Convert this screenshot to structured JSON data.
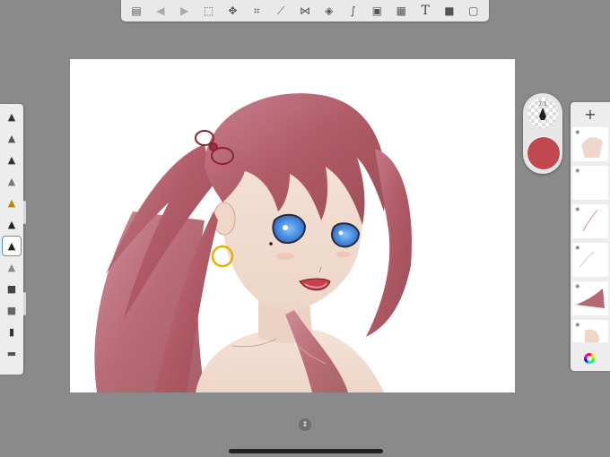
{
  "toolbar": {
    "items": [
      {
        "name": "gallery-icon",
        "glyph": "▤"
      },
      {
        "name": "undo-icon",
        "glyph": "◀"
      },
      {
        "name": "redo-icon",
        "glyph": "▶"
      },
      {
        "name": "selection-icon",
        "glyph": "⬚"
      },
      {
        "name": "transform-icon",
        "glyph": "✥"
      },
      {
        "name": "crop-icon",
        "glyph": "⌗"
      },
      {
        "name": "ruler-icon",
        "glyph": "⟋"
      },
      {
        "name": "symmetry-icon",
        "glyph": "⋈"
      },
      {
        "name": "fill-icon",
        "glyph": "◈"
      },
      {
        "name": "curve-icon",
        "glyph": "∫"
      },
      {
        "name": "image-icon",
        "glyph": "▣"
      },
      {
        "name": "perspective-icon",
        "glyph": "▦"
      },
      {
        "name": "text-icon",
        "glyph": "T"
      },
      {
        "name": "video-icon",
        "glyph": "■"
      },
      {
        "name": "fullscreen-icon",
        "glyph": "▢"
      }
    ]
  },
  "brushes": [
    {
      "name": "brush-pencil-tool",
      "glyph": "▲",
      "color": "#333"
    },
    {
      "name": "brush-pencil",
      "glyph": "▲",
      "color": "#555"
    },
    {
      "name": "brush-pen",
      "glyph": "▲",
      "color": "#333"
    },
    {
      "name": "brush-marker",
      "glyph": "▲",
      "color": "#777"
    },
    {
      "name": "brush-airbrush",
      "glyph": "▲",
      "color": "#b8860b"
    },
    {
      "name": "brush-paintbrush",
      "glyph": "▲",
      "color": "#222"
    },
    {
      "name": "brush-ink",
      "glyph": "▲",
      "color": "#222",
      "active": true
    },
    {
      "name": "brush-eraser",
      "glyph": "▲",
      "color": "#888"
    },
    {
      "name": "brush-blender",
      "glyph": "■",
      "color": "#444"
    },
    {
      "name": "brush-smudge",
      "glyph": "■",
      "color": "#666"
    },
    {
      "name": "brush-fill",
      "glyph": "▮",
      "color": "#333"
    },
    {
      "name": "brush-texture",
      "glyph": "▬",
      "color": "#555"
    }
  ],
  "color_puck": {
    "size_value": "7.1",
    "current_color": "#c0484e"
  },
  "layers": {
    "add_label": "+",
    "thumbs": [
      {
        "name": "layer-thumb-1"
      },
      {
        "name": "layer-thumb-2"
      },
      {
        "name": "layer-thumb-3"
      },
      {
        "name": "layer-thumb-4"
      },
      {
        "name": "layer-thumb-5"
      },
      {
        "name": "layer-thumb-6"
      }
    ]
  },
  "colors": {
    "hair": "#b86a74",
    "skin": "#f3dfd1",
    "eyes": "#2f7fd8",
    "earring": "#e0b400"
  }
}
